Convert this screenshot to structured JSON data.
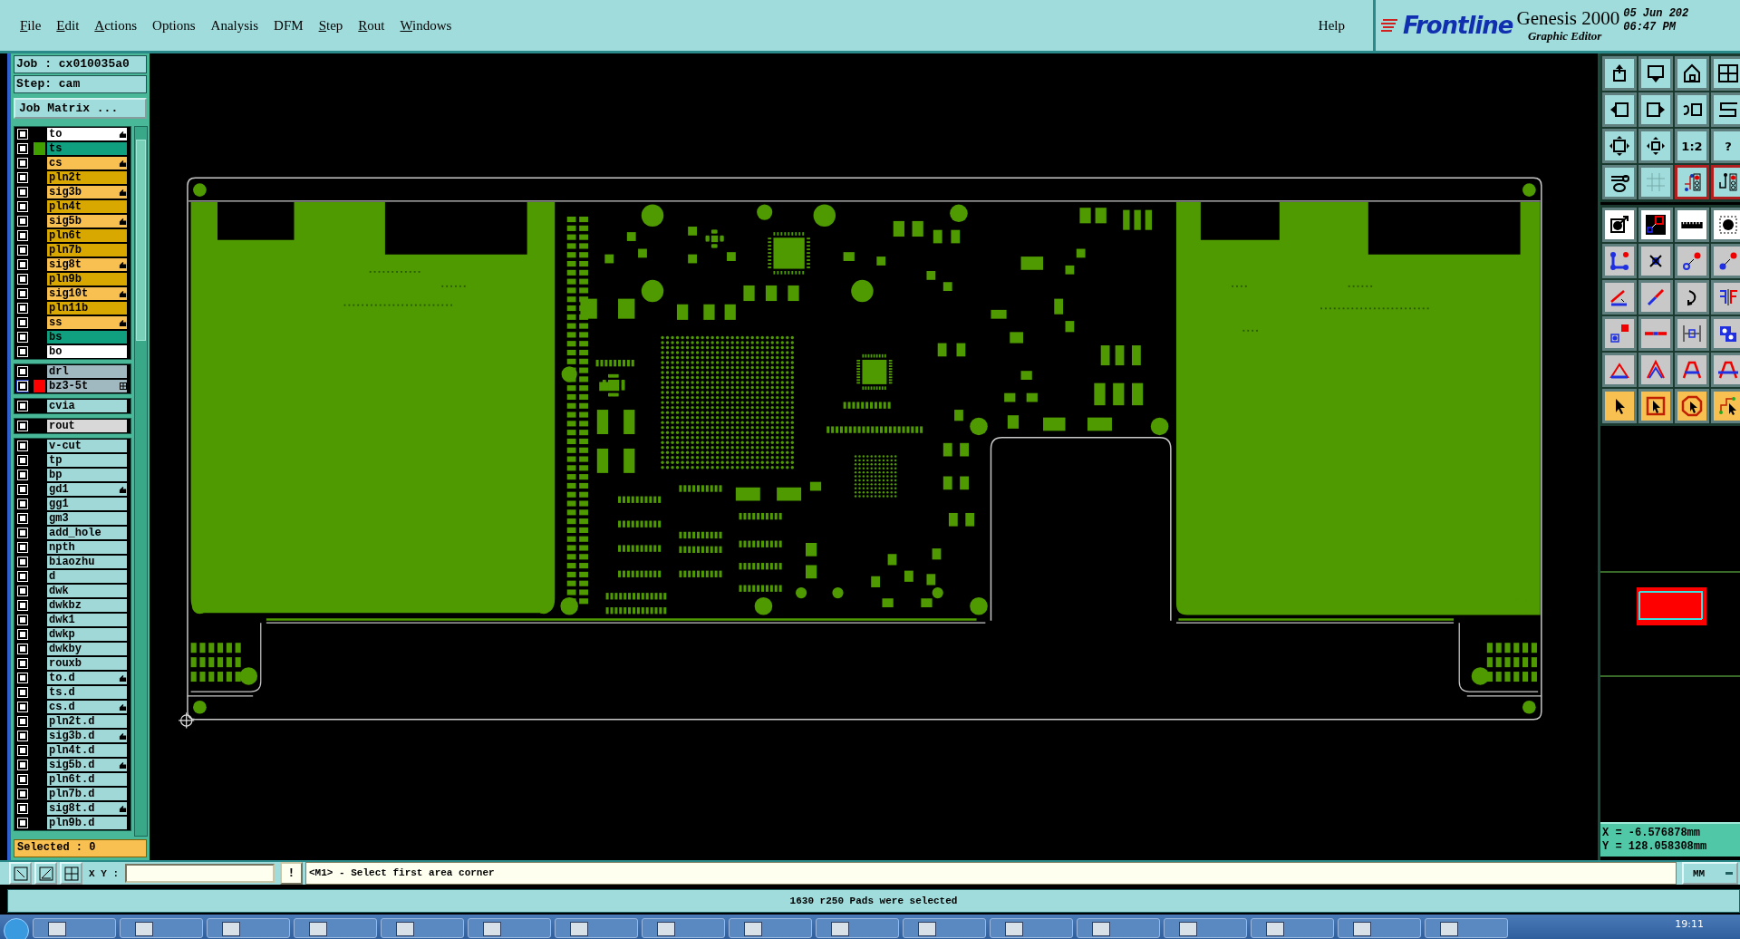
{
  "menu": [
    {
      "label": "File",
      "mnemonic": true
    },
    {
      "label": "Edit",
      "mnemonic": true
    },
    {
      "label": "Actions",
      "mnemonic": true
    },
    {
      "label": "Options",
      "mnemonic": false
    },
    {
      "label": "Analysis",
      "mnemonic": false
    },
    {
      "label": "DFM",
      "mnemonic": false
    },
    {
      "label": "Step",
      "mnemonic": true
    },
    {
      "label": "Rout",
      "mnemonic": true
    },
    {
      "label": "Windows",
      "mnemonic": true
    }
  ],
  "help": "Help",
  "brand": {
    "logo": "Frontline",
    "product": "Genesis 2000",
    "subtitle": "Graphic Editor",
    "date": "05 Jun 202",
    "time": "06:47 PM"
  },
  "job": {
    "job_line": "Job : cx010035a0",
    "step_line": "Step: cam",
    "matrix_button": "Job Matrix ..."
  },
  "layer_groups": [
    {
      "layers": [
        {
          "name": "to",
          "color": "#ffffff",
          "kind": "hand",
          "work": false
        },
        {
          "name": "ts",
          "color": "#10a080",
          "swatch": {
            "color": "#40a000"
          },
          "kind": "plain",
          "work": false
        },
        {
          "name": "cs",
          "color": "#f8c050",
          "kind": "hand",
          "work": false
        },
        {
          "name": "pln2t",
          "color": "#d8a800",
          "kind": "plain",
          "work": false
        },
        {
          "name": "sig3b",
          "color": "#f8c050",
          "kind": "hand",
          "work": false
        },
        {
          "name": "pln4t",
          "color": "#d8a800",
          "kind": "plain",
          "work": false
        },
        {
          "name": "sig5b",
          "color": "#f8c050",
          "kind": "hand",
          "work": false
        },
        {
          "name": "pln6t",
          "color": "#d8a800",
          "kind": "plain",
          "work": false
        },
        {
          "name": "pln7b",
          "color": "#d8a800",
          "kind": "plain",
          "work": false
        },
        {
          "name": "sig8t",
          "color": "#f8c050",
          "kind": "hand",
          "work": false
        },
        {
          "name": "pln9b",
          "color": "#d8a800",
          "kind": "plain",
          "work": false
        },
        {
          "name": "sig10t",
          "color": "#f8c050",
          "kind": "hand",
          "work": false
        },
        {
          "name": "pln11b",
          "color": "#d8a800",
          "kind": "plain",
          "work": false
        },
        {
          "name": "ss",
          "color": "#f8c050",
          "kind": "hand",
          "work": false
        },
        {
          "name": "bs",
          "color": "#10a080",
          "kind": "plain",
          "work": false
        },
        {
          "name": "bo",
          "color": "#ffffff",
          "kind": "plain",
          "work": false
        }
      ]
    },
    {
      "layers": [
        {
          "name": "drl",
          "color": "#a0b8c0",
          "kind": "plain",
          "work": false
        },
        {
          "name": "bz3-5t",
          "color": "#a0b8c0",
          "swatch": {
            "color": "#ff0000"
          },
          "kind": "grid",
          "work": true
        }
      ]
    },
    {
      "layers": [
        {
          "name": "cvia",
          "color": "#a0d8d8",
          "kind": "plain",
          "work": false
        }
      ]
    },
    {
      "layers": [
        {
          "name": "rout",
          "color": "#d8d8d8",
          "kind": "plain",
          "work": false
        }
      ]
    },
    {
      "layers": [
        {
          "name": "v-cut",
          "color": "#a0d8d8",
          "kind": "plain",
          "work": false
        },
        {
          "name": "tp",
          "color": "#a0d8d8",
          "kind": "plain",
          "work": false
        },
        {
          "name": "bp",
          "color": "#a0d8d8",
          "kind": "plain",
          "work": false
        },
        {
          "name": "gd1",
          "color": "#a0d8d8",
          "kind": "hand",
          "work": false
        },
        {
          "name": "gg1",
          "color": "#a0d8d8",
          "kind": "plain",
          "work": false
        },
        {
          "name": "gm3",
          "color": "#a0d8d8",
          "kind": "plain",
          "work": false
        },
        {
          "name": "add_hole",
          "color": "#a0d8d8",
          "kind": "plain",
          "work": false
        },
        {
          "name": "npth",
          "color": "#a0d8d8",
          "kind": "plain",
          "work": false
        },
        {
          "name": "biaozhu",
          "color": "#a0d8d8",
          "kind": "plain",
          "work": false
        },
        {
          "name": "d",
          "color": "#a0d8d8",
          "kind": "plain",
          "work": false
        },
        {
          "name": "dwk",
          "color": "#a0d8d8",
          "kind": "plain",
          "work": false
        },
        {
          "name": "dwkbz",
          "color": "#a0d8d8",
          "kind": "plain",
          "work": false
        },
        {
          "name": "dwk1",
          "color": "#a0d8d8",
          "kind": "plain",
          "work": false
        },
        {
          "name": "dwkp",
          "color": "#a0d8d8",
          "kind": "plain",
          "work": false
        },
        {
          "name": "dwkby",
          "color": "#a0d8d8",
          "kind": "plain",
          "work": false
        },
        {
          "name": "rouxb",
          "color": "#a0d8d8",
          "kind": "plain",
          "work": false
        },
        {
          "name": "to.d",
          "color": "#a0d8d8",
          "kind": "hand",
          "work": false
        },
        {
          "name": "ts.d",
          "color": "#a0d8d8",
          "kind": "plain",
          "work": false
        },
        {
          "name": "cs.d",
          "color": "#a0d8d8",
          "kind": "hand",
          "work": false
        },
        {
          "name": "pln2t.d",
          "color": "#a0d8d8",
          "kind": "plain",
          "work": false
        },
        {
          "name": "sig3b.d",
          "color": "#a0d8d8",
          "kind": "hand",
          "work": false
        },
        {
          "name": "pln4t.d",
          "color": "#a0d8d8",
          "kind": "plain",
          "work": false
        },
        {
          "name": "sig5b.d",
          "color": "#a0d8d8",
          "kind": "hand",
          "work": false
        },
        {
          "name": "pln6t.d",
          "color": "#a0d8d8",
          "kind": "plain",
          "work": false
        },
        {
          "name": "pln7b.d",
          "color": "#a0d8d8",
          "kind": "plain",
          "work": false
        },
        {
          "name": "sig8t.d",
          "color": "#a0d8d8",
          "kind": "hand",
          "work": false
        },
        {
          "name": "pln9b.d",
          "color": "#a0d8d8",
          "kind": "plain",
          "work": false
        }
      ]
    }
  ],
  "selected_count": "Selected : 0",
  "toolbar": [
    {
      "kind": "view",
      "buttons": [
        {
          "active": false
        },
        {
          "active": false
        },
        {
          "active": false
        },
        {
          "active": false
        }
      ]
    },
    {
      "kind": "view",
      "buttons": [
        {
          "active": false
        },
        {
          "active": false
        },
        {
          "active": false
        },
        {
          "active": false
        }
      ]
    },
    {
      "kind": "view",
      "buttons": [
        {
          "active": false
        },
        {
          "active": false
        },
        {
          "active": false,
          "label": "1:2"
        },
        {
          "active": false,
          "label": "?"
        }
      ]
    },
    {
      "kind": "view",
      "buttons": [
        {
          "active": false
        },
        {
          "active": false
        },
        {
          "active": true
        },
        {
          "active": true
        }
      ]
    },
    {
      "kind": "measure",
      "buttons": [
        {
          "active": false
        },
        {
          "active": false
        },
        {
          "active": false
        },
        {
          "active": false
        }
      ]
    },
    {
      "kind": "edit",
      "buttons": [
        {
          "active": false
        },
        {
          "active": false
        },
        {
          "active": false
        },
        {
          "active": false
        }
      ]
    },
    {
      "kind": "edit",
      "buttons": [
        {
          "active": false
        },
        {
          "active": false
        },
        {
          "active": false
        },
        {
          "active": false
        }
      ]
    },
    {
      "kind": "edit",
      "buttons": [
        {
          "active": false
        },
        {
          "active": false
        },
        {
          "active": false
        },
        {
          "active": false
        }
      ]
    },
    {
      "kind": "edit",
      "buttons": [
        {
          "active": false
        },
        {
          "active": false
        },
        {
          "active": false
        },
        {
          "active": false
        }
      ]
    },
    {
      "kind": "select",
      "buttons": [
        {
          "active": false
        },
        {
          "active": false
        },
        {
          "active": false
        },
        {
          "active": false
        }
      ]
    }
  ],
  "coordinates": {
    "x": "X = -6.576878mm",
    "y": "Y = 128.058308mm"
  },
  "command_bar": {
    "xy_label": "X Y :",
    "bang": "!",
    "prompt": "<M1> - Select first area corner",
    "units": "MM"
  },
  "status": "1630 r250 Pads were selected",
  "taskbar": {
    "clock": "19:11"
  }
}
